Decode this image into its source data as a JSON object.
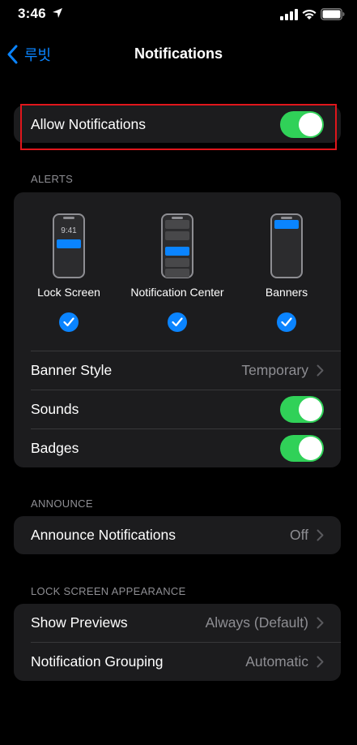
{
  "status_bar": {
    "time": "3:46"
  },
  "nav": {
    "back_label": "루빗",
    "title": "Notifications"
  },
  "allow": {
    "label": "Allow Notifications",
    "enabled": true
  },
  "alerts": {
    "header": "ALERTS",
    "styles": [
      {
        "label": "Lock Screen",
        "preview_time": "9:41",
        "checked": true
      },
      {
        "label": "Notification Center",
        "checked": true
      },
      {
        "label": "Banners",
        "checked": true
      }
    ],
    "banner_style": {
      "label": "Banner Style",
      "value": "Temporary"
    },
    "sounds": {
      "label": "Sounds",
      "enabled": true
    },
    "badges": {
      "label": "Badges",
      "enabled": true
    }
  },
  "announce": {
    "header": "ANNOUNCE",
    "announce_notifications": {
      "label": "Announce Notifications",
      "value": "Off"
    }
  },
  "lock_screen": {
    "header": "LOCK SCREEN APPEARANCE",
    "show_previews": {
      "label": "Show Previews",
      "value": "Always (Default)"
    },
    "grouping": {
      "label": "Notification Grouping",
      "value": "Automatic"
    }
  },
  "colors": {
    "accent": "#0a84ff",
    "toggle_on": "#30d158",
    "highlight": "#e0161c"
  }
}
